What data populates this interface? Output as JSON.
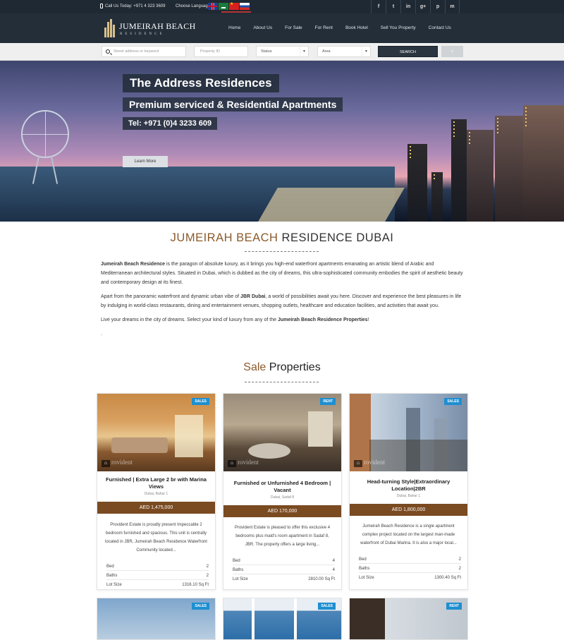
{
  "topbar": {
    "phone": "Call Us Today: +971 4 323 3609",
    "language_label": "Choose Language:",
    "languages": [
      "English",
      "Arabic",
      "Chinese",
      "Russian"
    ],
    "social": [
      "f",
      "t",
      "in",
      "g+",
      "p",
      "m"
    ]
  },
  "logo": {
    "title": "JUMEIRAH BEACH",
    "subtitle": "RESIDENCE"
  },
  "nav": {
    "items": [
      "Home",
      "About Us",
      "For Sale",
      "For Rent",
      "Book Hotel",
      "Sell You Property",
      "Contact Us"
    ]
  },
  "search": {
    "address_placeholder": "Street address or keyword",
    "property_id_placeholder": "Property ID",
    "status_value": "Status",
    "area_value": "Area",
    "search_label": "SEARCH",
    "extra_label": "≡"
  },
  "hero": {
    "title": "The Address Residences",
    "subtitle": "Premium serviced & Residential Apartments",
    "tel": "Tel: +971 (0)4 3233 609",
    "button": "Learn More"
  },
  "intro": {
    "heading_highlight": "JUMEIRAH BEACH",
    "heading_rest": " RESIDENCE DUBAI",
    "p1_bold": "Jumeirah Beach Residence",
    "p1_rest": " is the paragon of absolute luxury, as it brings you high-end waterfront apartments emanating an artistic blend of Arabic and Mediterranean architectural styles. Situated in Dubai, which is dubbed as the city of dreams, this ultra-sophisticated community embodies the spirit of aesthetic beauty and contemporary design at its finest.",
    "p2_start": "Apart from the panoramic waterfront and dynamic urban vibe of ",
    "p2_bold": "JBR Dubai",
    "p2_rest": ", a world of possibilities await you here. Discover and experience the best pleasures in life by indulging in world-class restaurants, dining and entertainment venues, shopping outlets, healthcare and education facilities, and activities that await you.",
    "p3_start": "Live your dreams in the city of dreams. Select your kind of luxury from any of the ",
    "p3_bold": "Jumeirah Beach Residence Properties",
    "p3_end": "!",
    "p4": "."
  },
  "sale_section": {
    "highlight": "Sale",
    "rest": " Properties"
  },
  "watermark": "rovident",
  "cards": [
    {
      "badge": "SALES",
      "title": "Furnished | Extra Large 2 br with Marina Views",
      "location": "Dubai, Bahar 1",
      "price": "AED 1,475,000",
      "description": "Provident Estate is proudly present Impeccable 2 bedroom furnished and spacious. This unit is centrally located in JBR, Jumeirah Beach Residence Waterfront Community located...",
      "bed_label": "Bed",
      "bed": "2",
      "baths_label": "Baths",
      "baths": "2",
      "size_label": "Lot Size",
      "size": "1316.10 Sq Ft"
    },
    {
      "badge": "RENT",
      "title": "Furnished or Unfurnished 4 Bedroom | Vacant",
      "location": "Dubai, Sadaf 8",
      "price": "AED 170,000",
      "description": "Provident Estate is pleased to offer this exclusive 4 bedrooms plus maid's room apartment in Sadaf 8, JBR. The property offers a large living...",
      "bed_label": "Bed",
      "bed": "4",
      "baths_label": "Baths",
      "baths": "4",
      "size_label": "Lot Size",
      "size": "2810.00 Sq Ft"
    },
    {
      "badge": "SALES",
      "title": "Head-turning Style|Extraordinary Location|2BR",
      "location": "Dubai, Bahar 1",
      "price": "AED 1,800,000",
      "description": "Jumeirah Beach Residence is a single apartment complex project located on the largest man-made waterfront of Dubai Marina. It is also a major local...",
      "bed_label": "Bed",
      "bed": "2",
      "baths_label": "Baths",
      "baths": "2",
      "size_label": "Lot Size",
      "size": "1300.40 Sq Ft"
    }
  ],
  "bottom_cards": [
    {
      "badge": "SALES"
    },
    {
      "badge": "SALES"
    },
    {
      "badge": "RENT"
    }
  ],
  "colors": {
    "accent_brown": "#7a4a21",
    "badge_blue": "#1e8fd0",
    "nav_dark": "#232e39"
  }
}
